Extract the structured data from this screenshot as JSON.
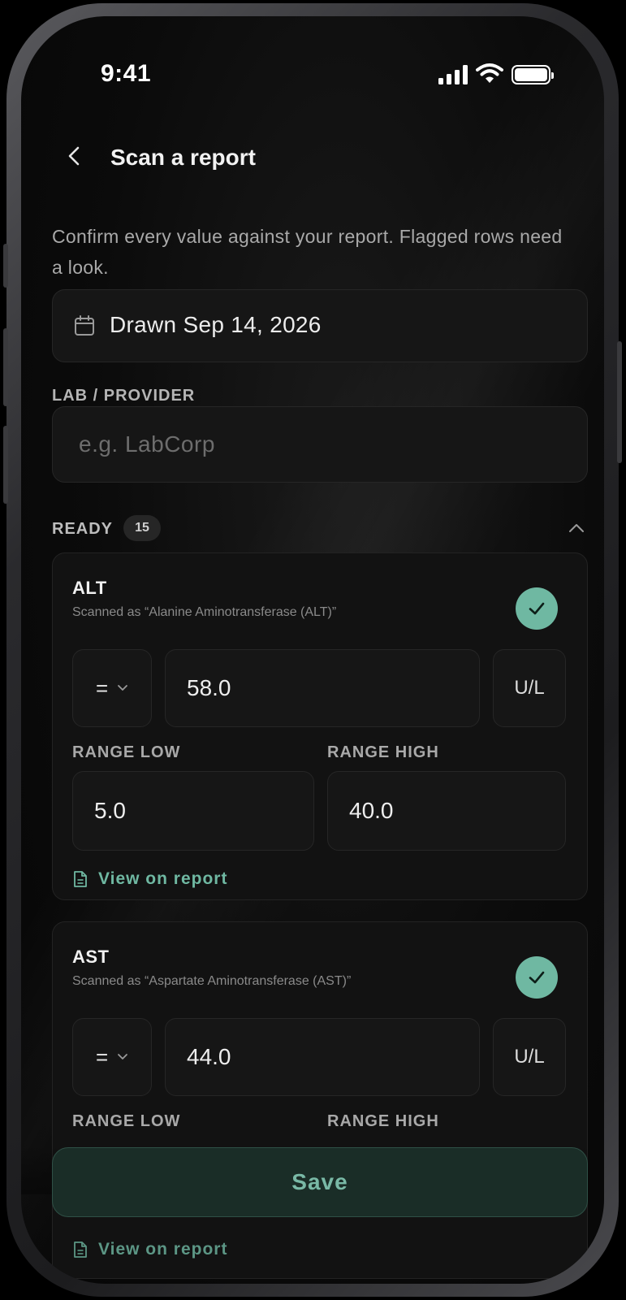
{
  "status_bar": {
    "time": "9:41"
  },
  "header": {
    "title": "Scan a report"
  },
  "intro": "Confirm every value against your report. Flagged rows need a look.",
  "date_field": {
    "value": "Drawn Sep 14, 2026"
  },
  "lab": {
    "label": "LAB / PROVIDER",
    "placeholder": "e.g. LabCorp",
    "value": ""
  },
  "section": {
    "title": "READY",
    "count": "15"
  },
  "results": [
    {
      "name": "ALT",
      "scanned_as": "Scanned as “Alanine Aminotransferase (ALT)”",
      "operator": "=",
      "value": "58.0",
      "unit": "U/L",
      "range_low_label": "RANGE LOW",
      "range_high_label": "RANGE HIGH",
      "range_low": "5.0",
      "range_high": "40.0",
      "view_link": "View on report"
    },
    {
      "name": "AST",
      "scanned_as": "Scanned as “Aspartate Aminotransferase (AST)”",
      "operator": "=",
      "value": "44.0",
      "unit": "U/L",
      "range_low_label": "RANGE LOW",
      "range_high_label": "RANGE HIGH",
      "view_link": "View on report"
    }
  ],
  "save_label": "Save",
  "colors": {
    "accent": "#6fb8a2",
    "save_bg": "#1a2d27",
    "background": "#0b0b0b"
  }
}
